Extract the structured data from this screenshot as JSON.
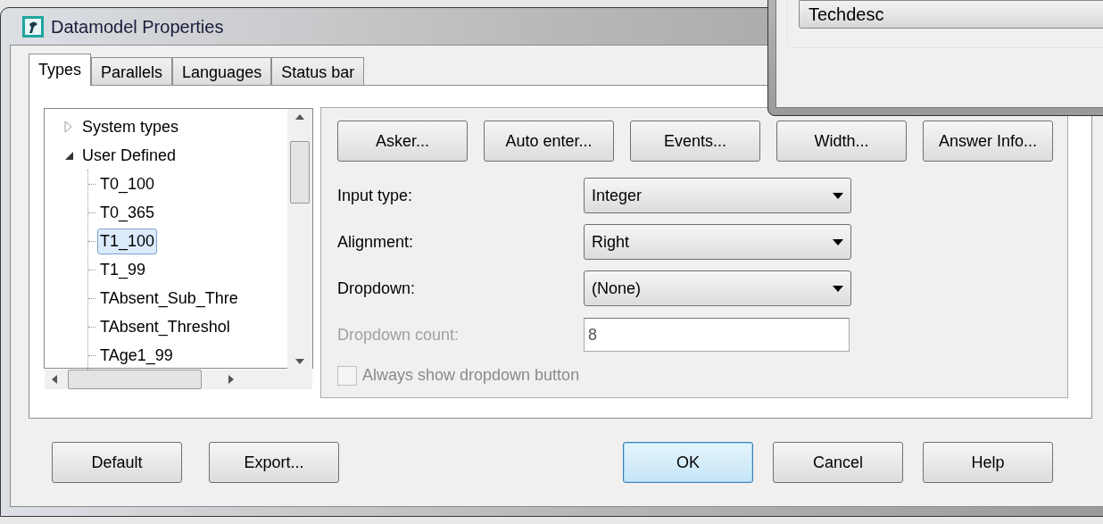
{
  "overlay_window": {
    "item": "Techdesc"
  },
  "window": {
    "title": "Datamodel Properties"
  },
  "tabs": [
    {
      "label": "Types",
      "selected": true
    },
    {
      "label": "Parallels",
      "selected": false
    },
    {
      "label": "Languages",
      "selected": false
    },
    {
      "label": "Status bar",
      "selected": false
    }
  ],
  "tree": [
    {
      "label": "System types",
      "expanded": false,
      "selected": false
    },
    {
      "label": "User Defined",
      "expanded": true,
      "selected": false,
      "children": [
        {
          "label": "T0_100",
          "selected": false
        },
        {
          "label": "T0_365",
          "selected": false
        },
        {
          "label": "T1_100",
          "selected": true
        },
        {
          "label": "T1_99",
          "selected": false
        },
        {
          "label": "TAbsent_Sub_Thre",
          "selected": false
        },
        {
          "label": "TAbsent_Threshol",
          "selected": false
        },
        {
          "label": "TAge1_99",
          "selected": false
        }
      ]
    }
  ],
  "action_buttons": [
    "Asker...",
    "Auto enter...",
    "Events...",
    "Width...",
    "Answer Info..."
  ],
  "fields": [
    {
      "kind": "select",
      "label": "Input type:",
      "value": "Integer",
      "disabled": false
    },
    {
      "kind": "select",
      "label": "Alignment:",
      "value": "Right",
      "disabled": false
    },
    {
      "kind": "select",
      "label": "Dropdown:",
      "value": "(None)",
      "disabled": false
    },
    {
      "kind": "text",
      "label": "Dropdown count:",
      "value": "8",
      "disabled": true
    }
  ],
  "checkbox": {
    "label": "Always show dropdown button",
    "checked": false,
    "disabled": true
  },
  "footer_left": [
    "Default",
    "Export..."
  ],
  "footer_right": [
    {
      "label": "OK",
      "default": true
    },
    {
      "label": "Cancel",
      "default": false
    },
    {
      "label": "Help",
      "default": false
    }
  ]
}
